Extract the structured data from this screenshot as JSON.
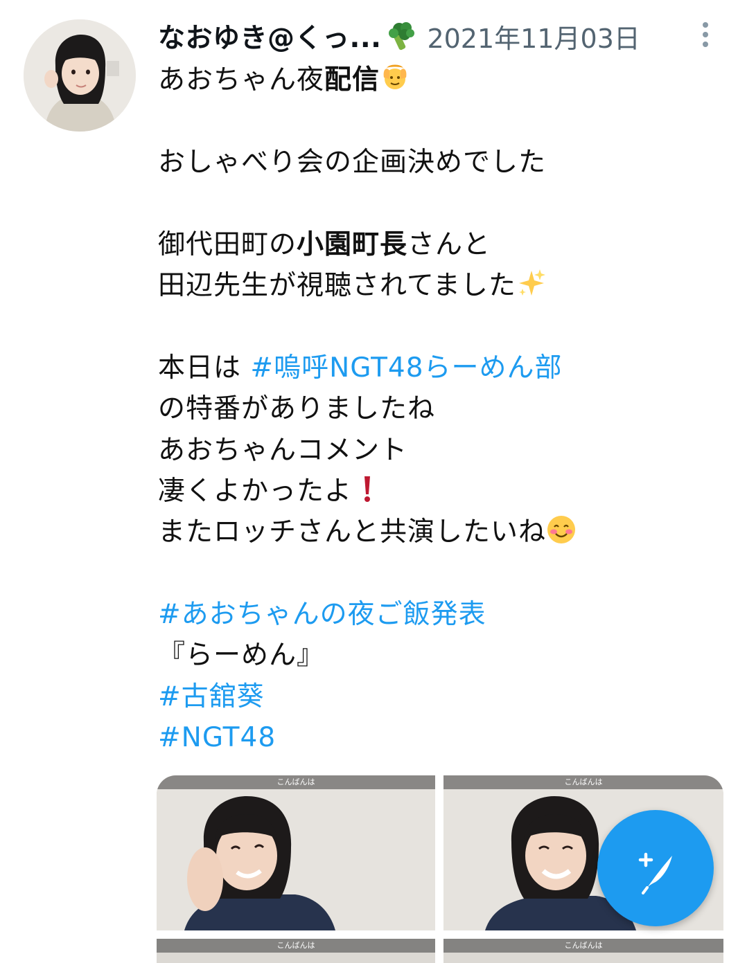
{
  "tweet": {
    "author_name": "なおゆき@くっ...",
    "date": "2021年11月03日",
    "lines": [
      {
        "segments": [
          {
            "text": "あおちゃん夜"
          },
          {
            "text": "配信",
            "bold": true
          }
        ],
        "emoji": "raising-hands-emoji"
      },
      {
        "segments": []
      },
      {
        "segments": [
          {
            "text": "おしゃべり会の企画決めでした"
          }
        ]
      },
      {
        "segments": []
      },
      {
        "segments": [
          {
            "text": "御代田町の"
          },
          {
            "text": "小園町長",
            "bold": true
          },
          {
            "text": "さんと"
          }
        ]
      },
      {
        "segments": [
          {
            "text": "田辺先生が視聴されてました"
          }
        ],
        "emoji": "sparkles-emoji"
      },
      {
        "segments": []
      },
      {
        "segments": [
          {
            "text": "本日は "
          },
          {
            "text": "#嗚呼NGT48らーめん部",
            "tag": true
          }
        ]
      },
      {
        "segments": [
          {
            "text": "の特番がありましたね"
          }
        ]
      },
      {
        "segments": [
          {
            "text": "あおちゃんコメント"
          }
        ]
      },
      {
        "segments": [
          {
            "text": "凄くよかったよ"
          }
        ],
        "emoji": "exclamation-emoji"
      },
      {
        "segments": [
          {
            "text": "またロッチさんと共演したいね"
          }
        ],
        "emoji": "smiling-face-emoji"
      },
      {
        "segments": []
      },
      {
        "segments": [
          {
            "text": "#あおちゃんの夜ご飯発表",
            "tag": true
          }
        ]
      },
      {
        "segments": [
          {
            "text": "『らーめん』"
          }
        ]
      },
      {
        "segments": [
          {
            "text": "#古舘葵",
            "tag": true
          }
        ]
      },
      {
        "segments": [
          {
            "text": "#NGT48",
            "tag": true
          }
        ]
      }
    ]
  },
  "media": {
    "captions": [
      "こんばんは",
      "こんばんは",
      "こんばんは",
      "こんばんは"
    ]
  },
  "icons": {
    "more": "more-vertical-icon",
    "compose": "compose-tweet-icon",
    "name_emoji": "broccoli-emoji"
  },
  "colors": {
    "hashtag": "#1d9bf0",
    "fab": "#1d9bf0",
    "secondary_text": "#536471"
  }
}
